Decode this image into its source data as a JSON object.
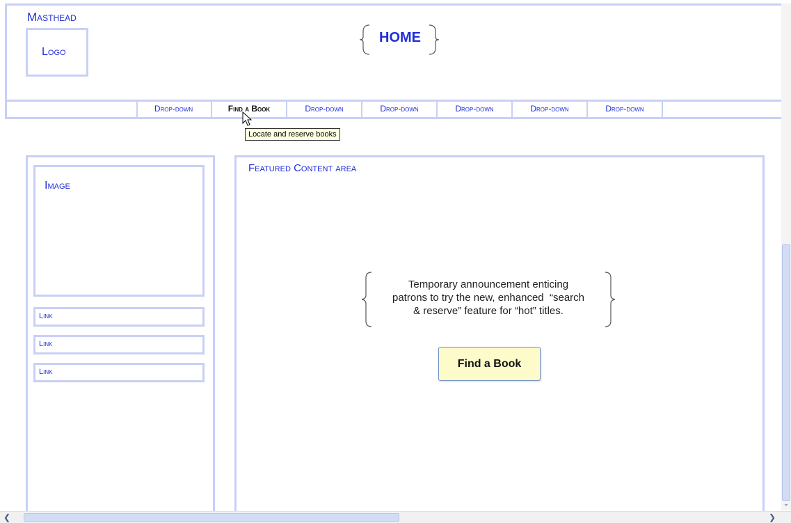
{
  "masthead": {
    "label": "Masthead",
    "logo_label": "Logo",
    "title": "HOME"
  },
  "nav": {
    "items": [
      {
        "label": "Drop-down",
        "active": false
      },
      {
        "label": "Find a Book",
        "active": true
      },
      {
        "label": "Drop-down",
        "active": false
      },
      {
        "label": "Drop-down",
        "active": false
      },
      {
        "label": "Drop-down",
        "active": false
      },
      {
        "label": "Drop-down",
        "active": false
      },
      {
        "label": "Drop-down",
        "active": false
      }
    ],
    "tooltip": "Locate and reserve books"
  },
  "sidebar": {
    "image_label": "Image",
    "links": [
      {
        "label": "Link"
      },
      {
        "label": "Link"
      },
      {
        "label": "Link"
      }
    ]
  },
  "featured": {
    "label": "Featured Content area",
    "announcement_lines": [
      "Temporary announcement enticing",
      "patrons to try the new, enhanced  “search",
      "& reserve” feature for “hot” titles."
    ],
    "button_label": "Find a Book"
  },
  "colors": {
    "frame": "#c8d0f5",
    "accent": "#1f2fd8",
    "button_bg": "#fdfbc9",
    "tooltip_bg": "#ffffe1"
  },
  "icons": {
    "cursor": "arrow-cursor-icon",
    "scroll_left": "chevron-left-icon",
    "scroll_right": "chevron-right-icon",
    "scroll_down": "chevron-down-icon"
  }
}
